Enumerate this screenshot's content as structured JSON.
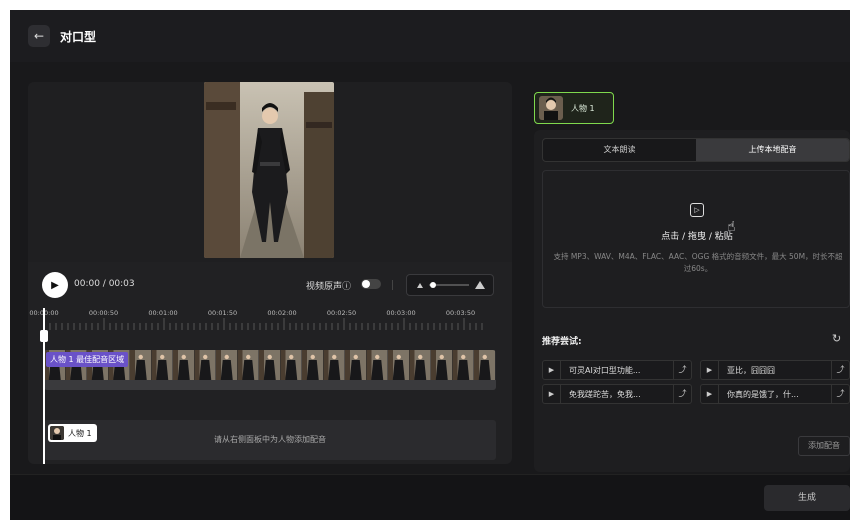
{
  "header": {
    "back_icon": "arrow-left-icon",
    "title": "对口型"
  },
  "player": {
    "time": "00:00 / 00:03",
    "original_sound_label": "视频原声ⓘ",
    "original_sound_on": false
  },
  "timeline": {
    "ticks": [
      "00:00:00",
      "00:00:50",
      "00:01:00",
      "00:01:50",
      "00:02:00",
      "00:02:50",
      "00:03:00",
      "00:03:50"
    ],
    "clip_label": "人物 1 最佳配音区域",
    "voice_chip": "人物 1",
    "voice_hint": "请从右侧面板中为人物添加配音"
  },
  "character": {
    "label": "人物 1",
    "accent": "#7fd94d"
  },
  "audio_panel": {
    "tabs": [
      "文本朗读",
      "上传本地配音"
    ],
    "active_tab": 1,
    "upload_title": "点击 / 拖曳 / 粘贴",
    "upload_desc": "支持 MP3、WAV、M4A、FLAC、AAC、OGG 格式的音频文件，最大 50M，时长不超过60s。",
    "recommend_title": "推荐尝试:",
    "recommendations": [
      "可灵AI对口型功能...",
      "亚比，囧囧囧",
      "免我蹉跎苦，免我...",
      "你真的是饿了，什..."
    ],
    "add_voice": "添加配音"
  },
  "footer": {
    "generate": "生成"
  },
  "colors": {
    "clip_tag": "#6a52c8",
    "background": "#141416"
  }
}
